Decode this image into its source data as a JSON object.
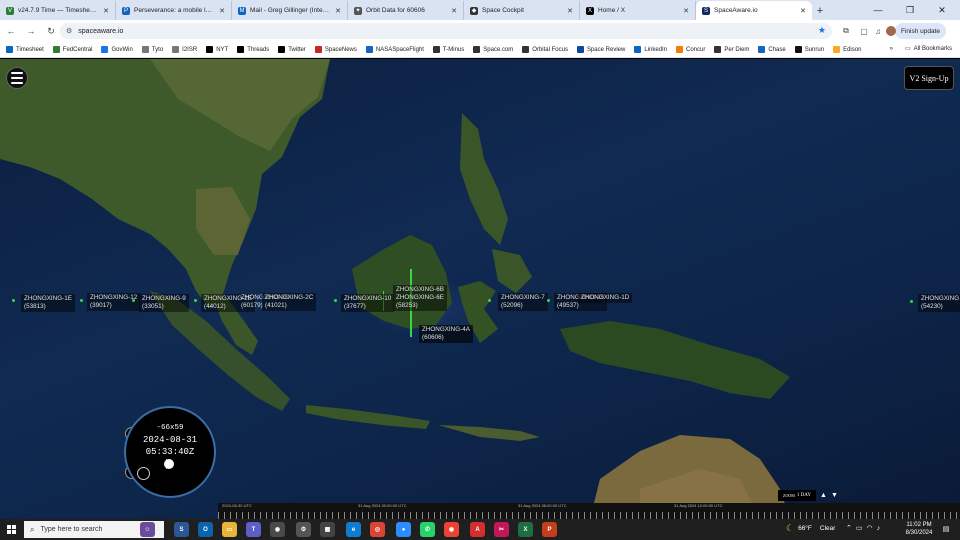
{
  "browser": {
    "tabs": [
      {
        "title": "v24.7.9 Time — Timesheet for U...",
        "icon_color": "#2e7d32",
        "icon": "V"
      },
      {
        "title": "Perseverance: a mobile laser system...",
        "icon_color": "#1565c0",
        "icon": "P"
      },
      {
        "title": "Mail - Greg Gillinger (Integrity...",
        "icon_color": "#0a66c2",
        "icon": "M"
      },
      {
        "title": "Orbit Data for 60606",
        "icon_color": "#555555",
        "icon": "✦"
      },
      {
        "title": "Space Cockpit",
        "icon_color": "#333333",
        "icon": "◆"
      },
      {
        "title": "Home / X",
        "icon_color": "#000000",
        "icon": "X"
      },
      {
        "title": "SpaceAware.io",
        "icon_color": "#0d2b5e",
        "icon": "S"
      }
    ],
    "new_tab": "+",
    "url": "spaceaware.io",
    "finish_update": "Finish update",
    "bookmarks": [
      {
        "label": "Timesheet",
        "color": "#0a66c2"
      },
      {
        "label": "FedCentral",
        "color": "#2e7d32"
      },
      {
        "label": "GovWin",
        "color": "#1a73e8"
      },
      {
        "label": "Tyto",
        "color": "#777777"
      },
      {
        "label": "I2ISR",
        "color": "#777777"
      },
      {
        "label": "NYT",
        "color": "#000000"
      },
      {
        "label": "Threads",
        "color": "#000000"
      },
      {
        "label": "Twitter",
        "color": "#000000"
      },
      {
        "label": "SpaceNews",
        "color": "#c62828"
      },
      {
        "label": "NASASpaceFlight",
        "color": "#1565c0"
      },
      {
        "label": "T-Minus",
        "color": "#333333"
      },
      {
        "label": "Space.com",
        "color": "#333333"
      },
      {
        "label": "Orbital Focus",
        "color": "#333333"
      },
      {
        "label": "Space Review",
        "color": "#0d47a1"
      },
      {
        "label": "LinkedIn",
        "color": "#0a66c2"
      },
      {
        "label": "Concur",
        "color": "#f57c00"
      },
      {
        "label": "Per Diem",
        "color": "#333333"
      },
      {
        "label": "Chase",
        "color": "#1565c0"
      },
      {
        "label": "Sunrun",
        "color": "#111111"
      },
      {
        "label": "Edison",
        "color": "#f9a825"
      }
    ],
    "more_bookmarks": "»",
    "all_bookmarks": "All Bookmarks"
  },
  "app": {
    "signup": "V2 Sign-Up",
    "satellites": [
      {
        "name": "ZHONGXING-1E",
        "id": "(53813)"
      },
      {
        "name": "ZHONGXING-12",
        "id": "(39017)"
      },
      {
        "name": "ZHONGXING-9",
        "id": "(33051)"
      },
      {
        "name": "ZHONGXING-2E",
        "id": "(44012)"
      },
      {
        "name": "ZHONGXING-2D",
        "id": "(60179)"
      },
      {
        "name": "ZHONGXING-2C",
        "id": "(41021)"
      },
      {
        "name": "ZHONGXING-10",
        "id": "(37677)"
      },
      {
        "name": "ZHONGXING-6B",
        "id": "(58253)"
      },
      {
        "name": "ZHONGXING-6E",
        "id": ""
      },
      {
        "name": "ZHONGXING-4A",
        "id": "(60606)"
      },
      {
        "name": "ZHONGXING-7",
        "id": "(52096)"
      },
      {
        "name": "ZHONGXING-20",
        "id": "(49537)"
      },
      {
        "name": "ZHONGXING-1D",
        "id": ""
      },
      {
        "name": "ZHONGXING",
        "id": "(54230)"
      }
    ],
    "clock": {
      "speed": "-66x59",
      "date": "2024-08-31",
      "time": "05:33:40Z"
    },
    "timeline": {
      "zoom_label": "ZOOM",
      "zoom_value": "1 DAY",
      "labels": [
        "2024-08-30 UTC",
        "31 Aug 2024 00:00:00 UTC",
        "31 Aug 2024 06:00:00 UTC",
        "31 Aug 2024 12:00:00 UTC"
      ]
    }
  },
  "taskbar": {
    "search_placeholder": "Type here to search",
    "weather_temp": "66°F",
    "weather_cond": "Clear",
    "time": "11:02 PM",
    "date": "8/30/2024"
  },
  "colors": {
    "accent": "#1a73e8",
    "satellite": "#3cd63c"
  }
}
